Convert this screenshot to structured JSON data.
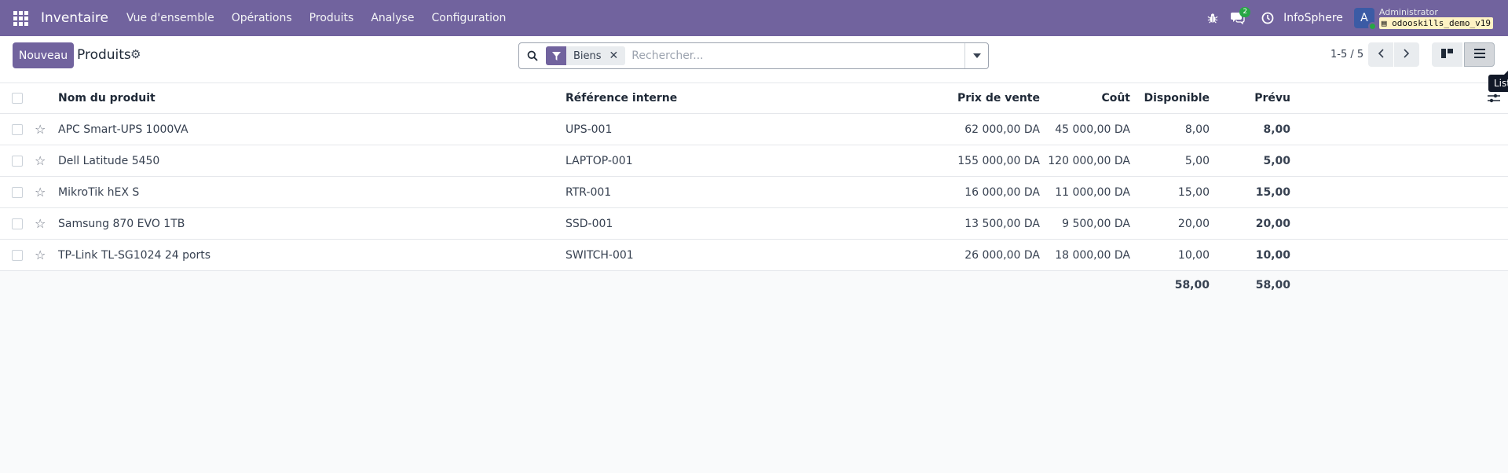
{
  "navbar": {
    "app_name": "Inventaire",
    "menu": [
      "Vue d'ensemble",
      "Opérations",
      "Produits",
      "Analyse",
      "Configuration"
    ],
    "messages_count": "2",
    "company": "InfoSphere",
    "avatar_letter": "A",
    "user_name": "Administrator",
    "database": "odooskills_demo_v19",
    "icons": [
      "apps-grid-icon",
      "bug-icon",
      "chat-icon",
      "clock-icon"
    ]
  },
  "control": {
    "new_label": "Nouveau",
    "title": "Produits",
    "search": {
      "facet_label": "Biens",
      "placeholder": "Rechercher..."
    },
    "pager": "1-5 / 5",
    "tooltip": "Liste"
  },
  "table": {
    "headers": {
      "name": "Nom du produit",
      "ref": "Référence interne",
      "price": "Prix de vente",
      "cost": "Coût",
      "available": "Disponible",
      "forecast": "Prévu"
    },
    "rows": [
      {
        "name": "APC Smart-UPS 1000VA",
        "ref": "UPS-001",
        "price": "62 000,00 DA",
        "cost": "45 000,00 DA",
        "available": "8,00",
        "forecast": "8,00"
      },
      {
        "name": "Dell Latitude 5450",
        "ref": "LAPTOP-001",
        "price": "155 000,00 DA",
        "cost": "120 000,00 DA",
        "available": "5,00",
        "forecast": "5,00"
      },
      {
        "name": "MikroTik hEX S",
        "ref": "RTR-001",
        "price": "16 000,00 DA",
        "cost": "11 000,00 DA",
        "available": "15,00",
        "forecast": "15,00"
      },
      {
        "name": "Samsung 870 EVO 1TB",
        "ref": "SSD-001",
        "price": "13 500,00 DA",
        "cost": "9 500,00 DA",
        "available": "20,00",
        "forecast": "20,00"
      },
      {
        "name": "TP-Link TL-SG1024 24 ports",
        "ref": "SWITCH-001",
        "price": "26 000,00 DA",
        "cost": "18 000,00 DA",
        "available": "10,00",
        "forecast": "10,00"
      }
    ],
    "totals": {
      "available": "58,00",
      "forecast": "58,00"
    }
  },
  "colors": {
    "brand": "#71639e",
    "success": "#28a745"
  }
}
